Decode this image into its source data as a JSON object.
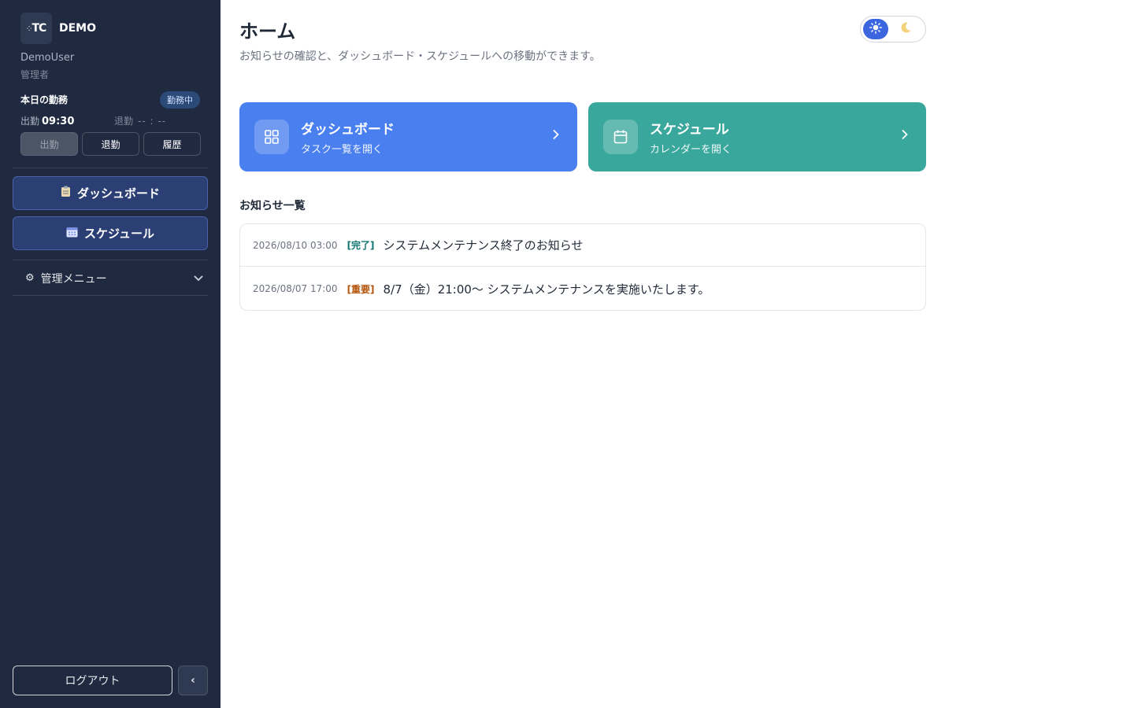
{
  "app": {
    "logo_text": "TC",
    "brand": "DEMO"
  },
  "user": {
    "name": "DemoUser",
    "role": "管理者"
  },
  "attendance": {
    "title": "本日の勤務",
    "status": "勤務中",
    "clock_in_label": "出勤",
    "clock_in_value": "09:30",
    "clock_out_label": "退勤",
    "clock_out_value": "-- : --",
    "buttons": {
      "clock_in": "出勤",
      "clock_out": "退勤",
      "history": "履歴"
    }
  },
  "nav": {
    "dashboard": "ダッシュボード",
    "schedule": "スケジュール",
    "admin_menu": "管理メニュー"
  },
  "footer": {
    "logout": "ログアウト",
    "collapse": "‹"
  },
  "page": {
    "title": "ホーム",
    "subtitle": "お知らせの確認と、ダッシュボード・スケジュールへの移動ができます。"
  },
  "theme": {
    "active": "light"
  },
  "cards": {
    "dashboard": {
      "title": "ダッシュボード",
      "subtitle": "タスク一覧を開く",
      "color": "#4a7ff0"
    },
    "schedule": {
      "title": "スケジュール",
      "subtitle": "カレンダーを開く",
      "color": "#3aa79d"
    }
  },
  "notices": {
    "heading": "お知らせ一覧",
    "items": [
      {
        "date": "2026/08/10 03:00",
        "tag": "[完了]",
        "text": "システムメンテナンス終了のお知らせ"
      },
      {
        "date": "2026/08/07 17:00",
        "tag": "[重要]",
        "text": "8/7（金）21:00〜 システムメンテナンスを実施いたします。"
      }
    ]
  }
}
